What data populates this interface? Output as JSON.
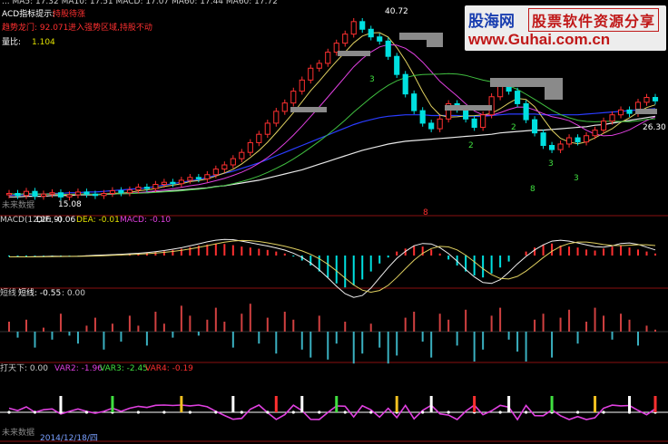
{
  "header": {
    "top_line": "... MA5: 17.32  MA10: 17.51  MACD: 17.07  MA60: 17.44  MA60: 17.72",
    "label1": "ACD指标提示:",
    "value1": "持股待涨",
    "label2": "趋势龙门: 92.071",
    "value2": "进入强势区域,持股不动",
    "label3": "量比:",
    "value3": "1.104"
  },
  "watermark": {
    "site_cn": "股海网",
    "tagline": "股票软件资源分享",
    "url": "www.Guhai.com.cn"
  },
  "price_panel": {
    "high_label": "40.72",
    "low_label": "15.08",
    "right_label": "26.30",
    "future_label": "未来数据",
    "mark_8": "8",
    "count_labels": [
      "3",
      "2",
      "2",
      "3",
      "8",
      "3"
    ],
    "colors": {
      "up": "#ff3030",
      "down": "#00e0e0",
      "ma_blue": "#2a3cff",
      "ma_white": "#e8e8e8",
      "ma_yellow": "#e0d060",
      "ma_green": "#40c040",
      "ma_magenta": "#e040e0"
    }
  },
  "macd_panel": {
    "title": "MACD(12,26,9)",
    "dif": "DIF: -0.06",
    "dea": "DEA: -0.01",
    "macd": "MACD: -0.10"
  },
  "bar_panel": {
    "title": "短线",
    "value1": "短线: -0.55",
    "value2": ": 0.00"
  },
  "bottom_panel": {
    "title": "打天下: 0.00",
    "var2": "VAR2: -1.96",
    "var3": "VAR3: -2.45",
    "var4": "VAR4: -0.19",
    "future_label": "未来数据",
    "date_label": "2014/12/18/四"
  },
  "chart_data": {
    "type": "line",
    "title": "",
    "xlabel": "",
    "ylabel": "",
    "series": [
      {
        "name": "price",
        "values": [
          15.5,
          15.2,
          15.8,
          15.1,
          15.4,
          15.6,
          15.0,
          15.3,
          15.7,
          15.4,
          15.2,
          15.5,
          15.9,
          15.6,
          16.0,
          16.4,
          16.2,
          16.8,
          17.1,
          16.9,
          17.4,
          17.8,
          17.6,
          18.2,
          19.0,
          19.6,
          20.5,
          21.4,
          22.8,
          24.0,
          25.6,
          27.3,
          28.5,
          30.2,
          31.8,
          33.5,
          34.2,
          35.8,
          37.1,
          38.4,
          40.2,
          39.1,
          38.0,
          37.4,
          35.2,
          32.6,
          29.8,
          27.4,
          25.6,
          24.8,
          26.2,
          28.4,
          27.6,
          26.2,
          25.0,
          26.8,
          29.4,
          31.0,
          30.2,
          28.4,
          26.1,
          24.2,
          22.4,
          21.8,
          22.6,
          23.5,
          22.9,
          23.8,
          24.6,
          25.9,
          26.8,
          27.5,
          27.0,
          28.6,
          29.3,
          28.8
        ]
      },
      {
        "name": "MA_blue",
        "values": [
          15.2,
          15.3,
          15.3,
          15.4,
          15.4,
          15.5,
          15.5,
          15.6,
          15.6,
          15.7,
          15.7,
          15.8,
          15.9,
          16.0,
          16.1,
          16.2,
          16.3,
          16.5,
          16.7,
          16.9,
          17.1,
          17.3,
          17.5,
          17.8,
          18.1,
          18.4,
          18.7,
          19.1,
          19.5,
          19.9,
          20.4,
          20.9,
          21.4,
          21.9,
          22.4,
          22.9,
          23.4,
          23.9,
          24.4,
          24.9,
          25.4,
          25.8,
          26.1,
          26.4,
          26.6,
          26.7,
          26.8,
          26.8,
          26.8,
          26.7,
          26.7,
          26.7,
          26.7,
          26.6,
          26.6,
          26.6,
          26.7,
          26.8,
          26.9,
          26.9,
          26.9,
          26.9,
          26.8,
          26.8,
          26.8,
          26.8,
          26.8,
          26.9,
          27.0,
          27.1,
          27.2,
          27.3,
          27.4,
          27.5,
          27.6,
          27.7
        ]
      },
      {
        "name": "MA_white",
        "values": [
          15.0,
          15.0,
          15.1,
          15.1,
          15.1,
          15.2,
          15.2,
          15.2,
          15.3,
          15.3,
          15.3,
          15.4,
          15.4,
          15.5,
          15.5,
          15.6,
          15.6,
          15.7,
          15.8,
          15.9,
          16.0,
          16.1,
          16.2,
          16.3,
          16.5,
          16.6,
          16.8,
          17.0,
          17.2,
          17.4,
          17.7,
          18.0,
          18.3,
          18.6,
          18.9,
          19.3,
          19.7,
          20.1,
          20.5,
          20.9,
          21.3,
          21.7,
          22.0,
          22.3,
          22.6,
          22.8,
          23.0,
          23.1,
          23.2,
          23.3,
          23.4,
          23.5,
          23.6,
          23.7,
          23.8,
          23.9,
          24.0,
          24.2,
          24.3,
          24.4,
          24.5,
          24.6,
          24.6,
          24.7,
          24.8,
          24.9,
          25.0,
          25.1,
          25.3,
          25.4,
          25.6,
          25.8,
          26.0,
          26.2,
          26.4,
          26.6
        ]
      }
    ],
    "macd_histogram": [
      -0.05,
      -0.04,
      -0.06,
      -0.03,
      -0.02,
      -0.03,
      -0.04,
      -0.02,
      -0.01,
      0.01,
      0.02,
      0.03,
      0.05,
      0.06,
      0.08,
      0.1,
      0.14,
      0.18,
      0.22,
      0.28,
      0.34,
      0.42,
      0.5,
      0.55,
      0.6,
      0.58,
      0.52,
      0.45,
      0.4,
      0.34,
      0.28,
      0.2,
      0.1,
      -0.05,
      -0.25,
      -0.5,
      -0.8,
      -1.1,
      -1.4,
      -1.6,
      -1.5,
      -1.2,
      -0.8,
      -0.4,
      -0.1,
      0.2,
      0.35,
      0.5,
      0.45,
      0.3,
      0.1,
      -0.2,
      -0.5,
      -0.8,
      -1.0,
      -1.1,
      -0.9,
      -0.6,
      -0.3,
      0.0,
      0.2,
      0.4,
      0.55,
      0.6,
      0.5,
      0.45,
      0.4,
      0.3,
      0.25,
      0.35,
      0.45,
      0.5,
      0.4,
      0.3,
      0.2,
      0.1
    ],
    "short_bars": [
      0.5,
      -0.3,
      0.6,
      -0.8,
      0.2,
      -0.4,
      0.9,
      -0.2,
      -0.6,
      0.3,
      0.7,
      -0.9,
      0.4,
      -0.5,
      0.8,
      0.3,
      -0.7,
      1.0,
      0.4,
      -0.3,
      1.3,
      0.8,
      -0.2,
      0.6,
      1.2,
      0.5,
      -0.8,
      0.9,
      1.4,
      -0.6,
      0.7,
      -1.1,
      1.0,
      0.6,
      -0.9,
      -1.3,
      0.8,
      -1.4,
      -0.6,
      0.5,
      -1.6,
      -1.1,
      0.4,
      -0.8,
      -1.6,
      -1.2,
      0.7,
      1.0,
      -0.5,
      -1.3,
      0.9,
      0.6,
      -0.7,
      1.1,
      -1.5,
      -0.9,
      0.8,
      1.2,
      -0.4,
      -1.0,
      -1.5,
      0.6,
      0.9,
      -1.3,
      0.7,
      1.1,
      -0.6,
      0.5,
      1.2,
      0.8,
      -0.4,
      0.9,
      0.6,
      -0.7,
      0.3,
      0.1
    ]
  }
}
